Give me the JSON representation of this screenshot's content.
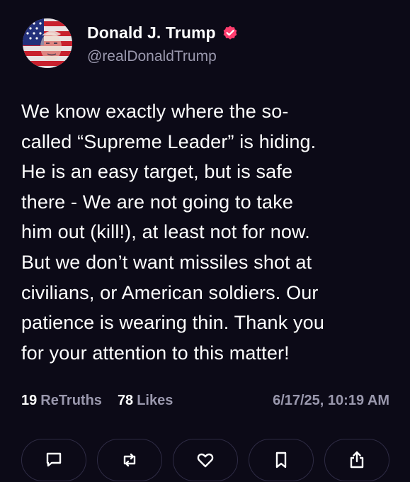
{
  "author": {
    "display_name": "Donald J. Trump",
    "handle": "@realDonaldTrump",
    "avatar_icon": "flag-portrait-avatar",
    "verified_icon": "verified-badge-icon",
    "verified_color": "#ff3d6e"
  },
  "post": {
    "text": "We know exactly where the so-\ncalled “Supreme Leader” is hiding.\nHe is an easy target, but is safe\nthere - We are not going to take\nhim out (kill!), at least not for now.\nBut we don’t want missiles shot at\ncivilians, or American soldiers. Our\npatience is wearing thin. Thank you\nfor your attention to this matter!"
  },
  "stats": {
    "retruths_count": "19",
    "retruths_label": "ReTruths",
    "likes_count": "78",
    "likes_label": "Likes",
    "timestamp": "6/17/25, 10:19 AM"
  },
  "actions": [
    {
      "icon": "reply-icon"
    },
    {
      "icon": "retruth-icon"
    },
    {
      "icon": "like-icon"
    },
    {
      "icon": "bookmark-icon"
    },
    {
      "icon": "share-icon"
    }
  ],
  "colors": {
    "background": "#0c0a17",
    "text_primary": "#ffffff",
    "text_secondary": "#9a98ad",
    "button_border": "#2e2b44",
    "accent": "#ff3d6e"
  }
}
